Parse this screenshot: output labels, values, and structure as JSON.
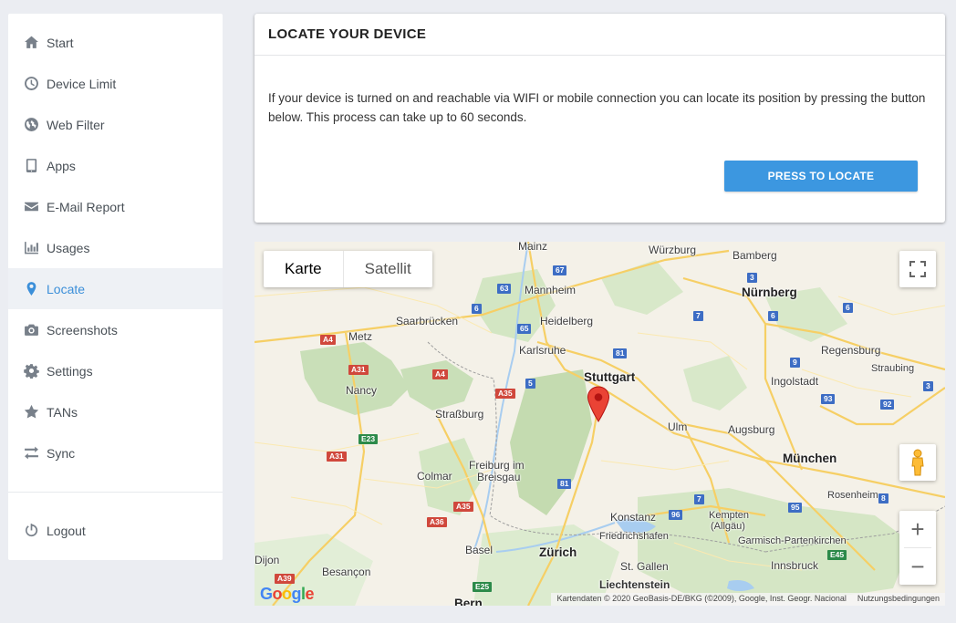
{
  "sidebar": {
    "items": [
      {
        "label": "Start",
        "icon": "home-icon"
      },
      {
        "label": "Device Limit",
        "icon": "clock-icon"
      },
      {
        "label": "Web Filter",
        "icon": "globe-icon"
      },
      {
        "label": "Apps",
        "icon": "tablet-icon"
      },
      {
        "label": "E-Mail Report",
        "icon": "envelope-icon"
      },
      {
        "label": "Usages",
        "icon": "bar-chart-icon"
      },
      {
        "label": "Locate",
        "icon": "map-marker-icon",
        "active": true
      },
      {
        "label": "Screenshots",
        "icon": "camera-icon"
      },
      {
        "label": "Settings",
        "icon": "gear-icon"
      },
      {
        "label": "TANs",
        "icon": "star-icon"
      },
      {
        "label": "Sync",
        "icon": "sync-arrows-icon"
      }
    ],
    "logout": {
      "label": "Logout",
      "icon": "power-icon"
    }
  },
  "locate": {
    "title": "LOCATE YOUR DEVICE",
    "description": "If your device is turned on and reachable via WIFI or mobile connection you can locate its position by pressing the button below. This process can take up to 60 seconds.",
    "button": "PRESS TO LOCATE",
    "accent": "#3c97e0"
  },
  "map": {
    "type_options": {
      "map": "Karte",
      "satellite": "Satellit"
    },
    "logo": "Google",
    "attribution": "Kartendaten © 2020 GeoBasis-DE/BKG (©2009), Google, Inst. Geogr. Nacional",
    "terms": "Nutzungsbedingungen",
    "zoom_in": "+",
    "zoom_out": "−",
    "places": {
      "mainz": "Mainz",
      "wuerzburg": "Würzburg",
      "bamberg": "Bamberg",
      "mannheim": "Mannheim",
      "nuernberg": "Nürnberg",
      "heidelberg": "Heidelberg",
      "saarbruecken": "Saarbrücken",
      "metz": "Metz",
      "karlsruhe": "Karlsruhe",
      "regensburg": "Regensburg",
      "stuttgart": "Stuttgart",
      "ingolstadt": "Ingolstadt",
      "straubing": "Straubing",
      "nancy": "Nancy",
      "strassburg": "Straßburg",
      "ulm": "Ulm",
      "augsburg": "Augsburg",
      "muenchen": "München",
      "colmar": "Colmar",
      "freiburg1": "Freiburg im",
      "freiburg2": "Breisgau",
      "rosenheim": "Rosenheim",
      "konstanz": "Konstanz",
      "kempten1": "Kempten",
      "kempten2": "(Allgäu)",
      "friedrichshafen": "Friedrichshafen",
      "garmisch": "Garmisch-Partenkirchen",
      "basel": "Basel",
      "zuerich": "Zürich",
      "stgallen": "St. Gallen",
      "innsbruck": "Innsbruck",
      "dijon": "Dijon",
      "besancon": "Besançon",
      "liechtenstein": "Liechtenstein",
      "bern": "Bern"
    },
    "roads": {
      "r67": "67",
      "r3a": "3",
      "r63": "63",
      "r6a": "6",
      "r6b": "6",
      "r6c": "6",
      "r65": "65",
      "r7a": "7",
      "r81a": "81",
      "r9": "9",
      "r5": "5",
      "r93": "93",
      "r92": "92",
      "r3b": "3",
      "r81b": "81",
      "r7b": "7",
      "r96": "96",
      "r95": "95",
      "r8": "8",
      "a4a": "A4",
      "a31a": "A31",
      "a4b": "A4",
      "a35a": "A35",
      "a31b": "A31",
      "a35b": "A35",
      "a36": "A36",
      "a39": "A39",
      "e23": "E23",
      "e45": "E45",
      "e25": "E25"
    }
  }
}
